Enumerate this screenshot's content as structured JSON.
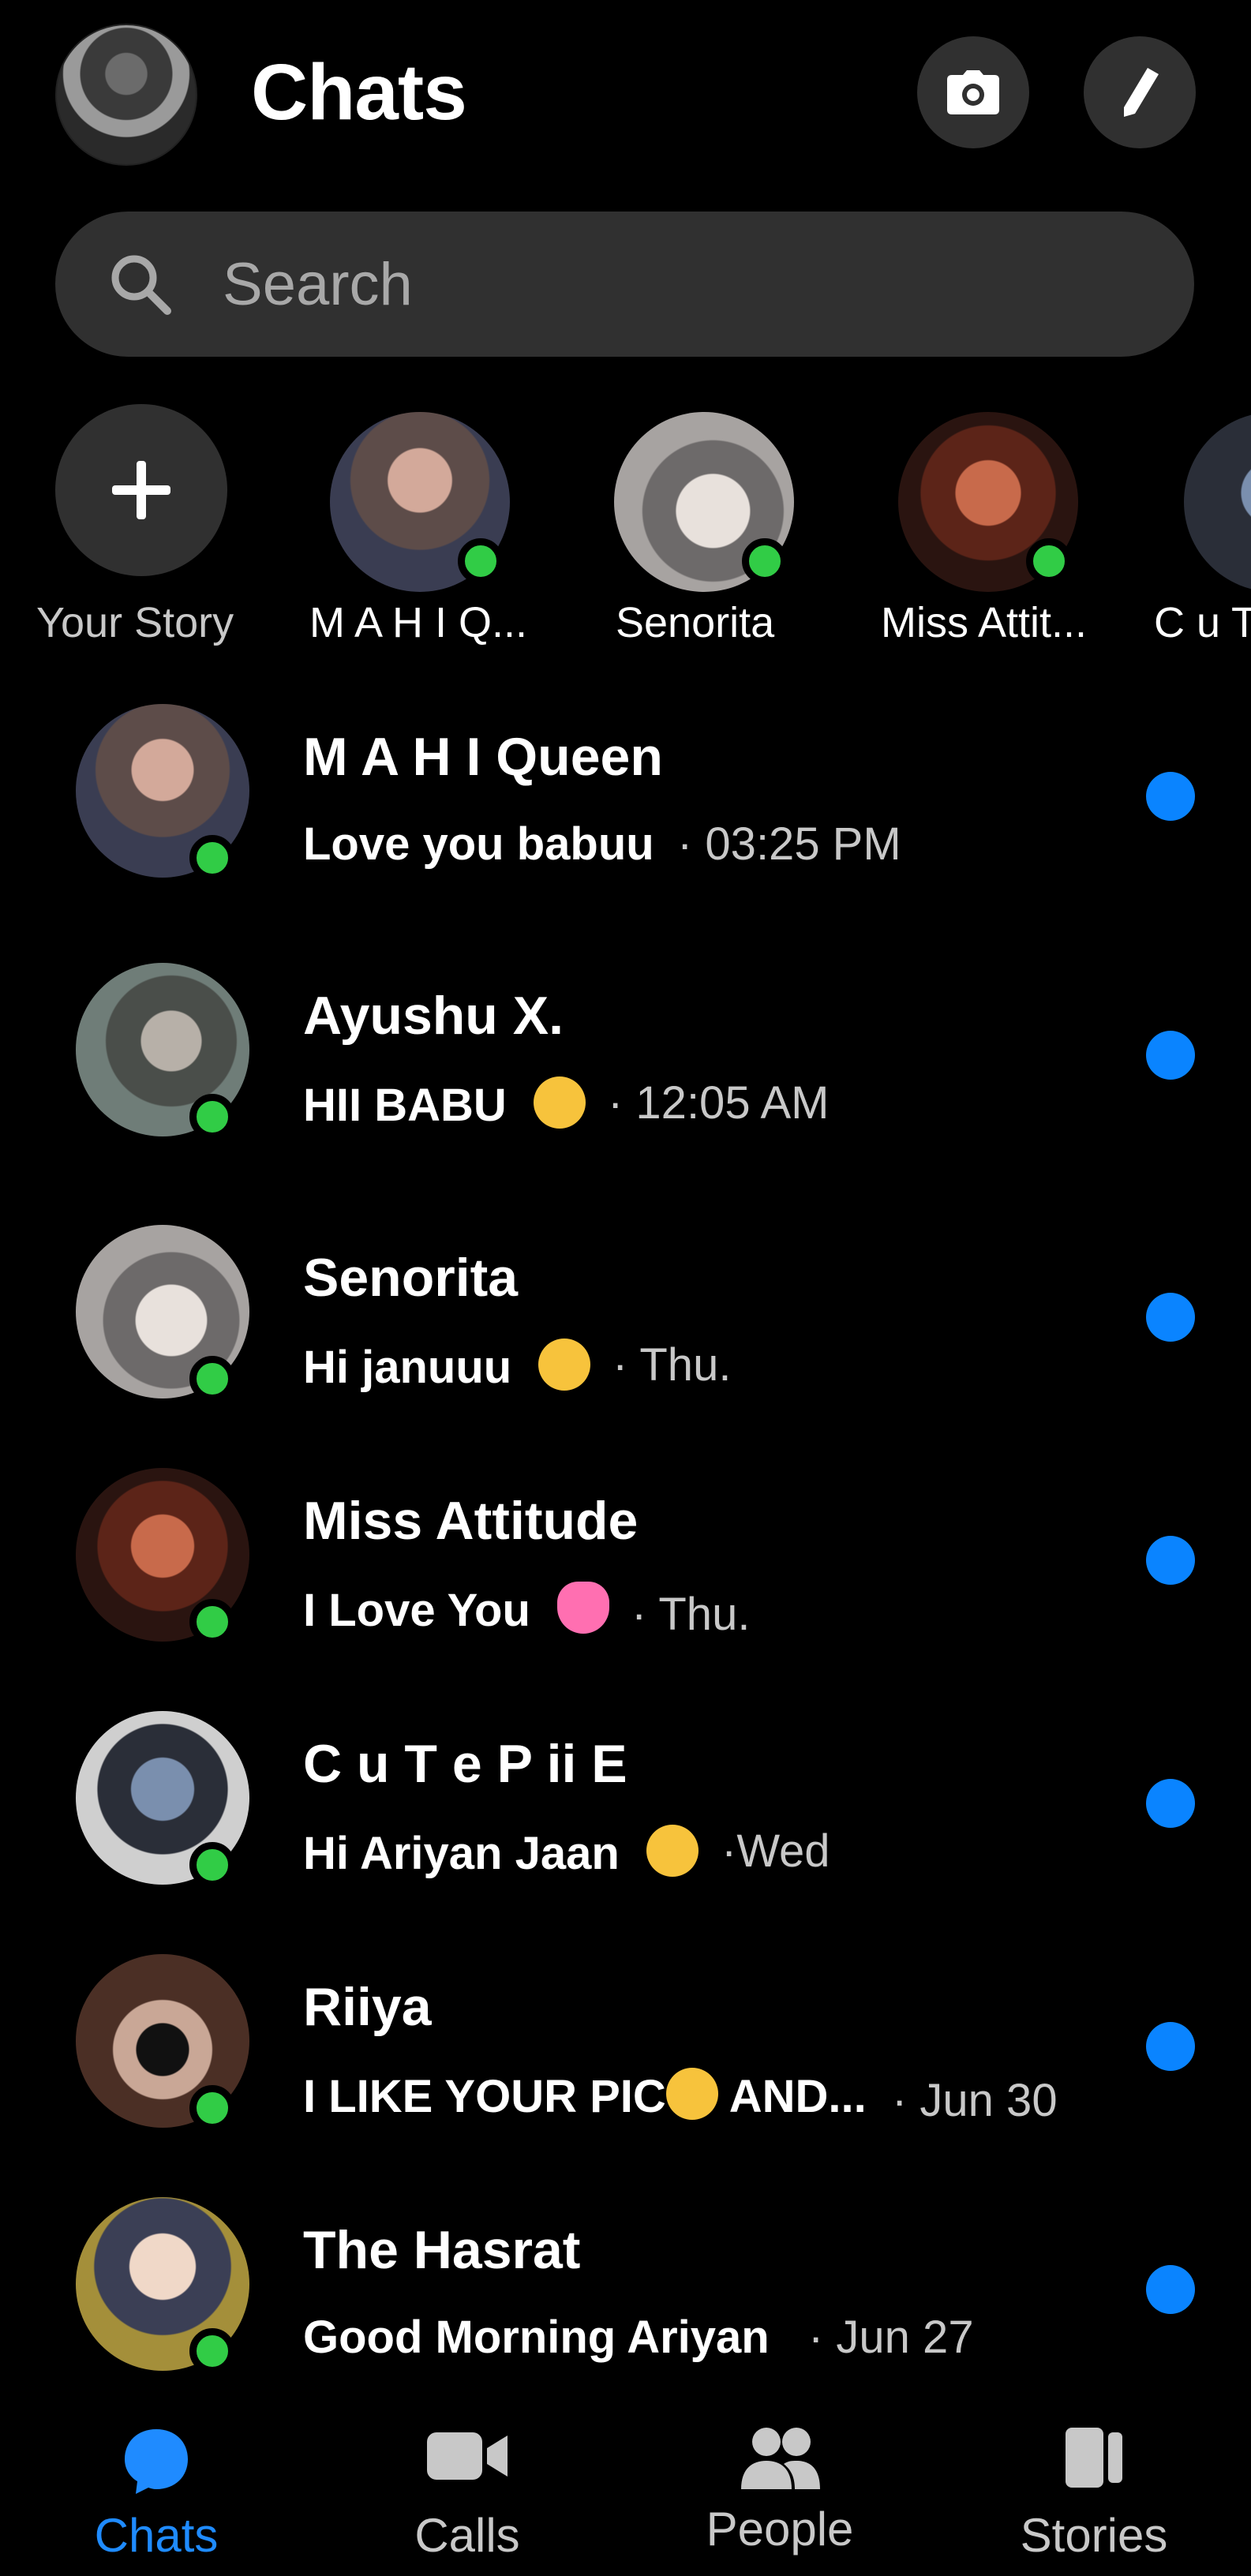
{
  "header": {
    "title": "Chats",
    "camera_icon": "camera-icon",
    "compose_icon": "pencil-icon"
  },
  "search": {
    "placeholder": "Search",
    "icon": "search-icon"
  },
  "stories": [
    {
      "label": "Your Story",
      "type": "add"
    },
    {
      "label": "M A H I Q..."
    },
    {
      "label": "Senorita"
    },
    {
      "label": "Miss Attit..."
    },
    {
      "label": "C u T"
    }
  ],
  "chats": [
    {
      "name": "M A H I Queen",
      "preview": "Love you babuu",
      "emoji": "",
      "time": "· 03:25 PM"
    },
    {
      "name": "Ayushu X.",
      "preview": "HII BABU",
      "emoji": "kiss-face",
      "time": "· 12:05 AM"
    },
    {
      "name": "Senorita",
      "preview": "Hi januuu",
      "emoji": "kiss-heart-face",
      "time": "· Thu."
    },
    {
      "name": "Miss Attitude",
      "preview": "I Love You",
      "emoji": "pink-heart",
      "time": "· Thu."
    },
    {
      "name": "C u T e P ii E",
      "preview": "Hi Ariyan Jaan",
      "emoji": "hearts-face",
      "time": "·Wed"
    },
    {
      "name": "Riiya",
      "preview": "I LIKE YOUR PIC",
      "emoji": "kiss-face",
      "preview_suffix": " AND...",
      "time": "· Jun 30"
    },
    {
      "name": "The Hasrat",
      "preview": "Good Morning Ariyan",
      "emoji": "",
      "time": "· Jun 27"
    }
  ],
  "nav": [
    {
      "label": "Chats",
      "icon": "chat-bubble-icon",
      "active": true
    },
    {
      "label": "Calls",
      "icon": "video-camera-icon"
    },
    {
      "label": "People",
      "icon": "people-icon"
    },
    {
      "label": "Stories",
      "icon": "stories-icon"
    }
  ],
  "colors": {
    "background": "#000000",
    "accent": "#0a84ff",
    "online": "#31cc46",
    "surface": "#303030"
  }
}
